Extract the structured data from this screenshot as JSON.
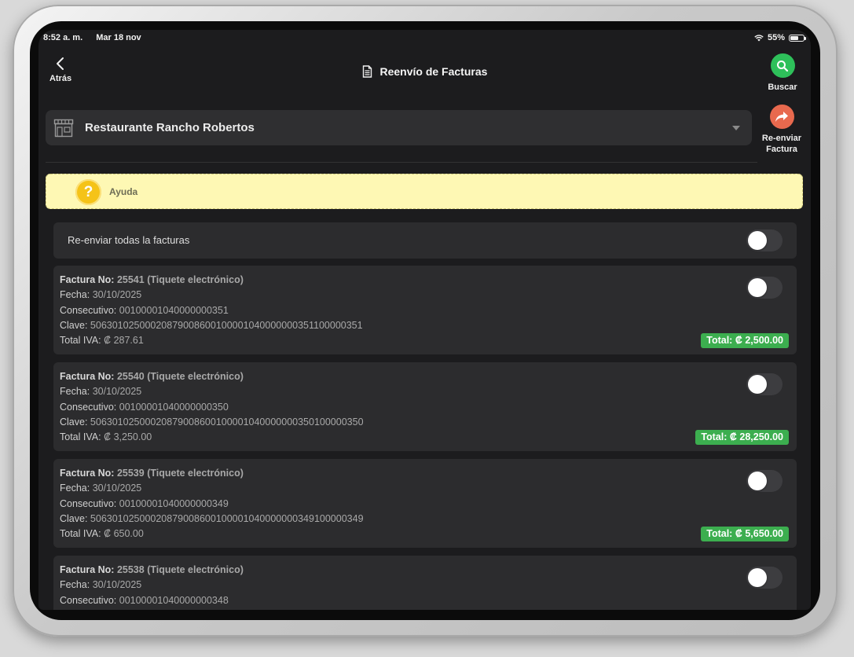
{
  "status_bar": {
    "time": "8:52 a. m.",
    "date": "Mar 18 nov",
    "battery": "55%"
  },
  "nav": {
    "back_label": "Atrás",
    "title": "Reenvío de Facturas",
    "search_label": "Buscar",
    "resend_label_line1": "Re-enviar",
    "resend_label_line2": "Factura"
  },
  "store_picker": {
    "selected": "Restaurante Rancho Robertos"
  },
  "help": {
    "label": "Ayuda"
  },
  "resend_all": {
    "label": "Re-enviar todas la facturas",
    "enabled": false
  },
  "labels": {
    "factura_no": "Factura No:",
    "fecha": "Fecha:",
    "consecutivo": "Consecutivo:",
    "clave": "Clave:",
    "total_iva": "Total IVA:",
    "total": "Total:"
  },
  "invoices": [
    {
      "number": "25541",
      "type": "(Tiquete electrónico)",
      "fecha": "30/10/2025",
      "consecutivo": "00100001040000000351",
      "clave": "50630102500020879008600100001040000000351100000351",
      "total_iva": "₡ 287.61",
      "total": "₡ 2,500.00",
      "enabled": false
    },
    {
      "number": "25540",
      "type": "(Tiquete electrónico)",
      "fecha": "30/10/2025",
      "consecutivo": "00100001040000000350",
      "clave": "50630102500020879008600100001040000000350100000350",
      "total_iva": "₡ 3,250.00",
      "total": "₡ 28,250.00",
      "enabled": false
    },
    {
      "number": "25539",
      "type": "(Tiquete electrónico)",
      "fecha": "30/10/2025",
      "consecutivo": "00100001040000000349",
      "clave": "50630102500020879008600100001040000000349100000349",
      "total_iva": "₡ 650.00",
      "total": "₡ 5,650.00",
      "enabled": false
    },
    {
      "number": "25538",
      "type": "(Tiquete electrónico)",
      "fecha": "30/10/2025",
      "consecutivo": "00100001040000000348",
      "enabled": false
    }
  ],
  "colors": {
    "search_button": "#2ec05a",
    "resend_button": "#e8694e",
    "help_banner": "#fef8b4",
    "total_badge": "#3cae4f"
  }
}
